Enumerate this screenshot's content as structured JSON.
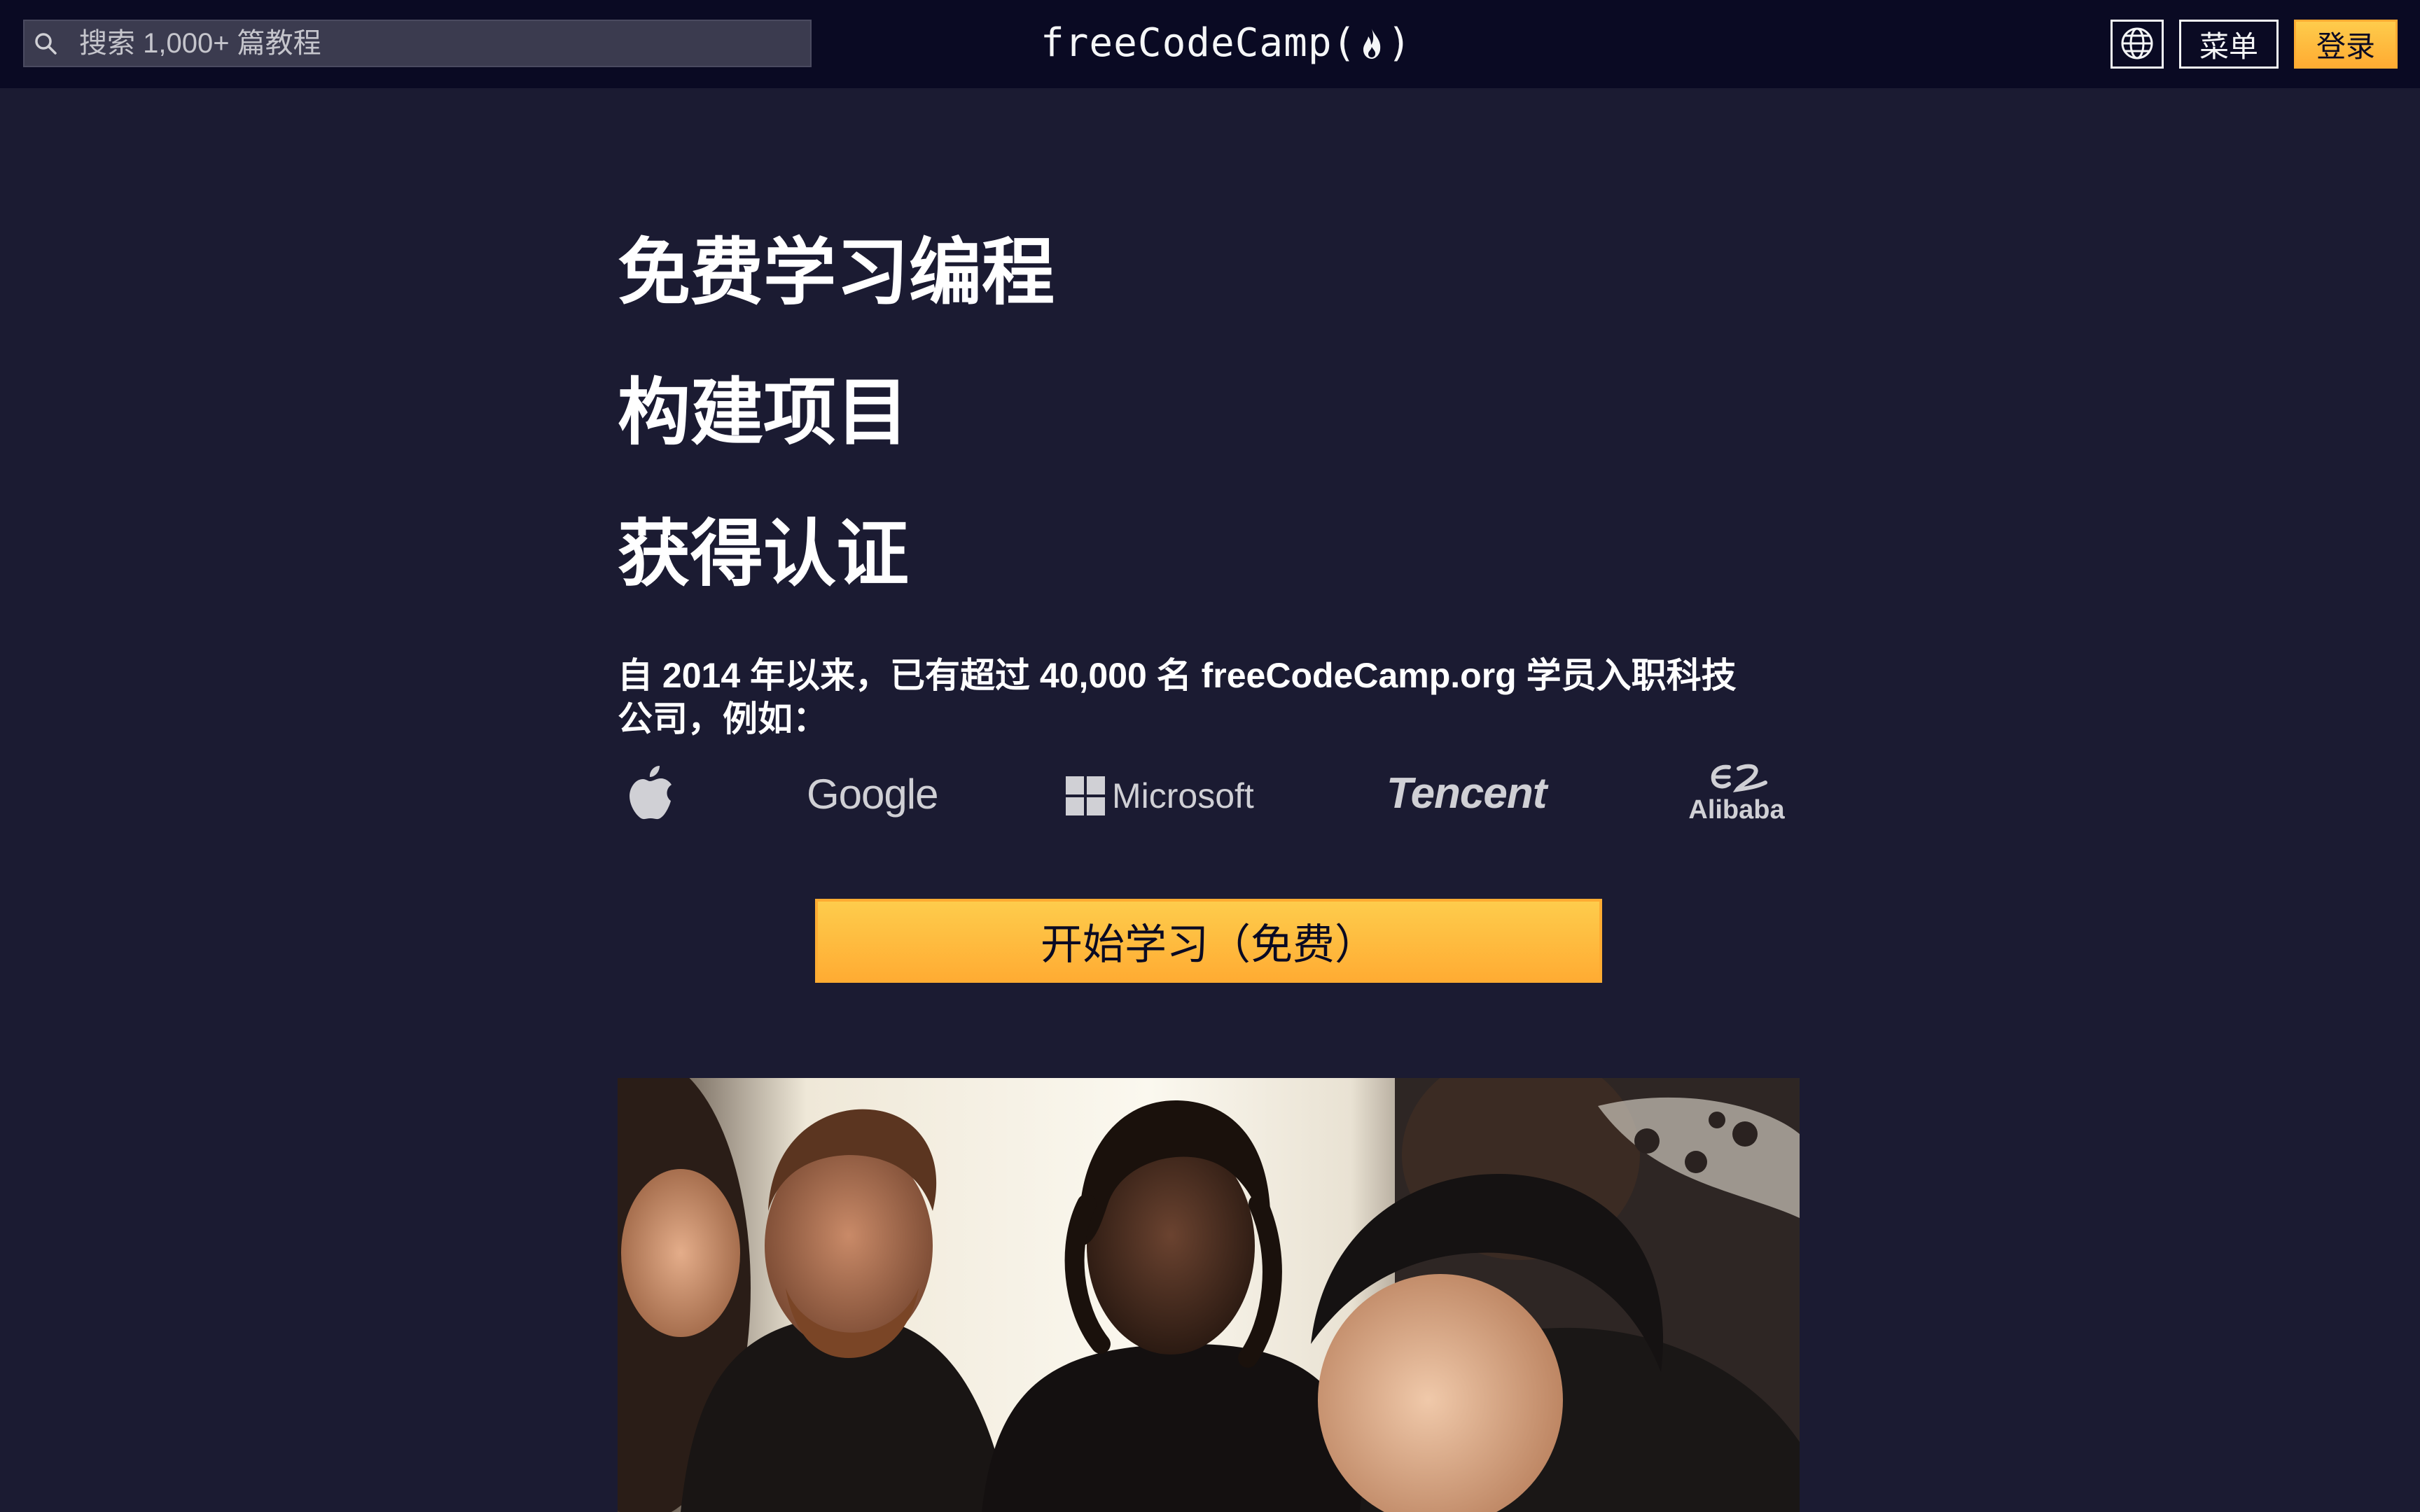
{
  "nav": {
    "search_placeholder": "搜索 1,000+ 篇教程",
    "brand_left": "freeCodeCamp(",
    "brand_right": ")",
    "menu_label": "菜单",
    "signin_label": "登录",
    "icons": [
      "search-icon",
      "flame-icon",
      "globe-icon"
    ]
  },
  "hero": {
    "line1": "免费学习编程",
    "line2": "构建项目",
    "line3": "获得认证",
    "subtitle": "自 2014 年以来，已有超过 40,000 名 freeCodeCamp.org 学员入职科技公司，例如："
  },
  "companies": {
    "apple": "Apple",
    "google": "Google",
    "microsoft": "Microsoft",
    "tencent": "Tencent",
    "alibaba": "Alibaba"
  },
  "cta": {
    "label": "开始学习（免费）"
  },
  "colors": {
    "nav_bg": "#0a0a23",
    "page_bg": "#1b1b32",
    "accent_yellow": "#feac32",
    "text_light": "#f5f6f7"
  }
}
